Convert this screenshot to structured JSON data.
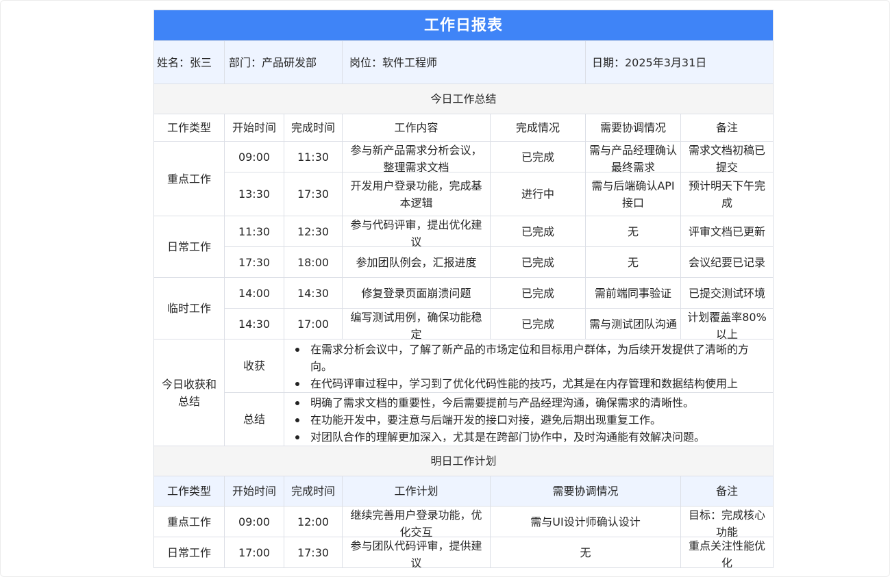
{
  "title": "工作日报表",
  "info": {
    "name": "姓名：张三",
    "dept": "部门：产品研发部",
    "position": "岗位：软件工程师",
    "date": "日期：2025年3月31日"
  },
  "today_section": "今日工作总结",
  "today_headers": [
    "工作类型",
    "开始时间",
    "完成时间",
    "工作内容",
    "完成情况",
    "需要协调情况",
    "备注"
  ],
  "today_groups": [
    {
      "type": "重点工作",
      "rows": [
        {
          "start": "09:00",
          "end": "11:30",
          "content": "参与新产品需求分析会议，整理需求文档",
          "status": "已完成",
          "coord": "需与产品经理确认最终需求",
          "note": "需求文档初稿已提交"
        },
        {
          "start": "13:30",
          "end": "17:30",
          "content": "开发用户登录功能，完成基本逻辑",
          "status": "进行中",
          "coord": "需与后端确认API接口",
          "note": "预计明天下午完成"
        }
      ]
    },
    {
      "type": "日常工作",
      "rows": [
        {
          "start": "11:30",
          "end": "12:30",
          "content": "参与代码评审，提出优化建议",
          "status": "已完成",
          "coord": "无",
          "note": "评审文档已更新"
        },
        {
          "start": "17:30",
          "end": "18:00",
          "content": "参加团队例会，汇报进度",
          "status": "已完成",
          "coord": "无",
          "note": "会议纪要已记录"
        }
      ]
    },
    {
      "type": "临时工作",
      "rows": [
        {
          "start": "14:00",
          "end": "14:30",
          "content": "修复登录页面崩溃问题",
          "status": "已完成",
          "coord": "需前端同事验证",
          "note": "已提交测试环境"
        },
        {
          "start": "14:30",
          "end": "17:00",
          "content": "编写测试用例，确保功能稳定",
          "status": "已完成",
          "coord": "需与测试团队沟通",
          "note": "计划覆盖率80%以上"
        }
      ]
    }
  ],
  "reflection": {
    "label": "今日收获和总结",
    "gains_label": "收获",
    "gains": [
      "在需求分析会议中，了解了新产品的市场定位和目标用户群体，为后续开发提供了清晰的方向。",
      "在代码评审过程中，学习到了优化代码性能的技巧，尤其是在内存管理和数据结构使用上"
    ],
    "summary_label": "总结",
    "summary": [
      "明确了需求文档的重要性，今后需要提前与产品经理沟通，确保需求的清晰性。",
      "在功能开发中，要注意与后端开发的接口对接，避免后期出现重复工作。",
      "对团队合作的理解更加深入，尤其是在跨部门协作中，及时沟通能有效解决问题。"
    ]
  },
  "tomorrow_section": "明日工作计划",
  "tomorrow_headers": [
    "工作类型",
    "开始时间",
    "完成时间",
    "工作计划",
    "需要协调情况",
    "备注"
  ],
  "tomorrow_rows": [
    {
      "type": "重点工作",
      "start": "09:00",
      "end": "12:00",
      "plan": "继续完善用户登录功能，优化交互",
      "coord": "需与UI设计师确认设计",
      "note": "目标：完成核心功能"
    },
    {
      "type": "日常工作",
      "start": "17:00",
      "end": "17:30",
      "plan": "参与团队代码评审，提供建议",
      "coord": "无",
      "note": "重点关注性能优化"
    }
  ]
}
